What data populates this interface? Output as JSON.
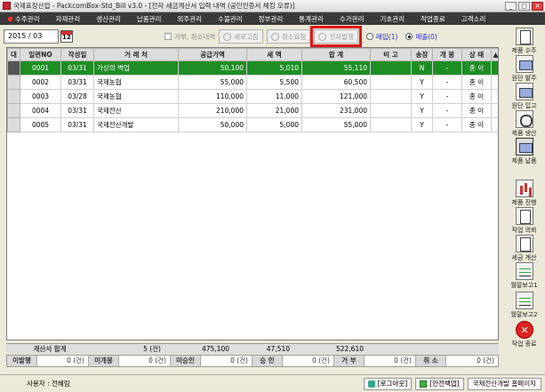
{
  "window": {
    "title": "국제표장산업 - PackcomBox-Std_Bill v3.0 - [전자 세금계산서 입력 내역  (공인인증서 체킹 오류)]",
    "min": "_",
    "max": "□",
    "close": "✕"
  },
  "menu": [
    "수주관리",
    "자재관리",
    "생산관리",
    "납품관리",
    "외주관리",
    "수불관리",
    "정부관리",
    "통계관리",
    "수가관리",
    "기초관리",
    "작업종료",
    "고객소리"
  ],
  "toolbar": {
    "date": "2015 / 03",
    "checkbox_label": "거부, 취소내역",
    "btn_print": "세로고침",
    "btn_cancel": "취소요청",
    "btn_send": "전자발행",
    "radio_purchase": "매입(1)",
    "radio_sales": "매출(0)"
  },
  "table": {
    "headers": [
      "대",
      "일련NO",
      "작성일",
      "거 래 처",
      "공급가액",
      "세 액",
      "합 계",
      "비 고",
      "송장",
      "개 봉",
      "상 태",
      "▲"
    ],
    "rows": [
      {
        "no": "0001",
        "date": "03/31",
        "client": "가상의 벽업",
        "supply": "50,100",
        "tax": "5,010",
        "total": "55,110",
        "note": "",
        "invoice": "N",
        "open": "-",
        "status": "종 이"
      },
      {
        "no": "0002",
        "date": "03/31",
        "client": "국제농협",
        "supply": "55,000",
        "tax": "5,500",
        "total": "60,500",
        "note": "",
        "invoice": "Y",
        "open": "-",
        "status": "종 이"
      },
      {
        "no": "0003",
        "date": "03/28",
        "client": "국제농협",
        "supply": "110,000",
        "tax": "11,000",
        "total": "121,000",
        "note": "",
        "invoice": "Y",
        "open": "-",
        "status": "종 이"
      },
      {
        "no": "0004",
        "date": "03/31",
        "client": "국제전산",
        "supply": "210,000",
        "tax": "21,000",
        "total": "231,000",
        "note": "",
        "invoice": "Y",
        "open": "-",
        "status": "종 이"
      },
      {
        "no": "0005",
        "date": "03/31",
        "client": "국제전산개발",
        "supply": "50,000",
        "tax": "5,000",
        "total": "55,000",
        "note": "",
        "invoice": "Y",
        "open": "-",
        "status": "종 이"
      }
    ]
  },
  "summary": {
    "label": "계산서 합계",
    "count": "5 (건)",
    "supply": "475,100",
    "tax": "47,510",
    "total": "522,610"
  },
  "status_bar": [
    {
      "label": "미발행",
      "value": "0 (건)"
    },
    {
      "label": "미개봉",
      "value": "0 (건)"
    },
    {
      "label": "미승인",
      "value": "0 (건)"
    },
    {
      "label": "승 인",
      "value": "0 (건)"
    },
    {
      "label": "거 부",
      "value": "0 (건)"
    },
    {
      "label": "취 소",
      "value": "0 (건)"
    }
  ],
  "footer": {
    "user": "사용자 : 전혜림",
    "logout": "[로그아웃]",
    "backup": "[안전백업]",
    "company": "국제전산개발 홈페이지"
  },
  "sidebar": [
    "제품 수주",
    "원단 발주",
    "원단 입고",
    "제품 생산",
    "제품 납품",
    "제품 진행",
    "작업 의뢰",
    "세금 계산",
    "월말보고1",
    "월말보고2",
    "작업 종료"
  ]
}
